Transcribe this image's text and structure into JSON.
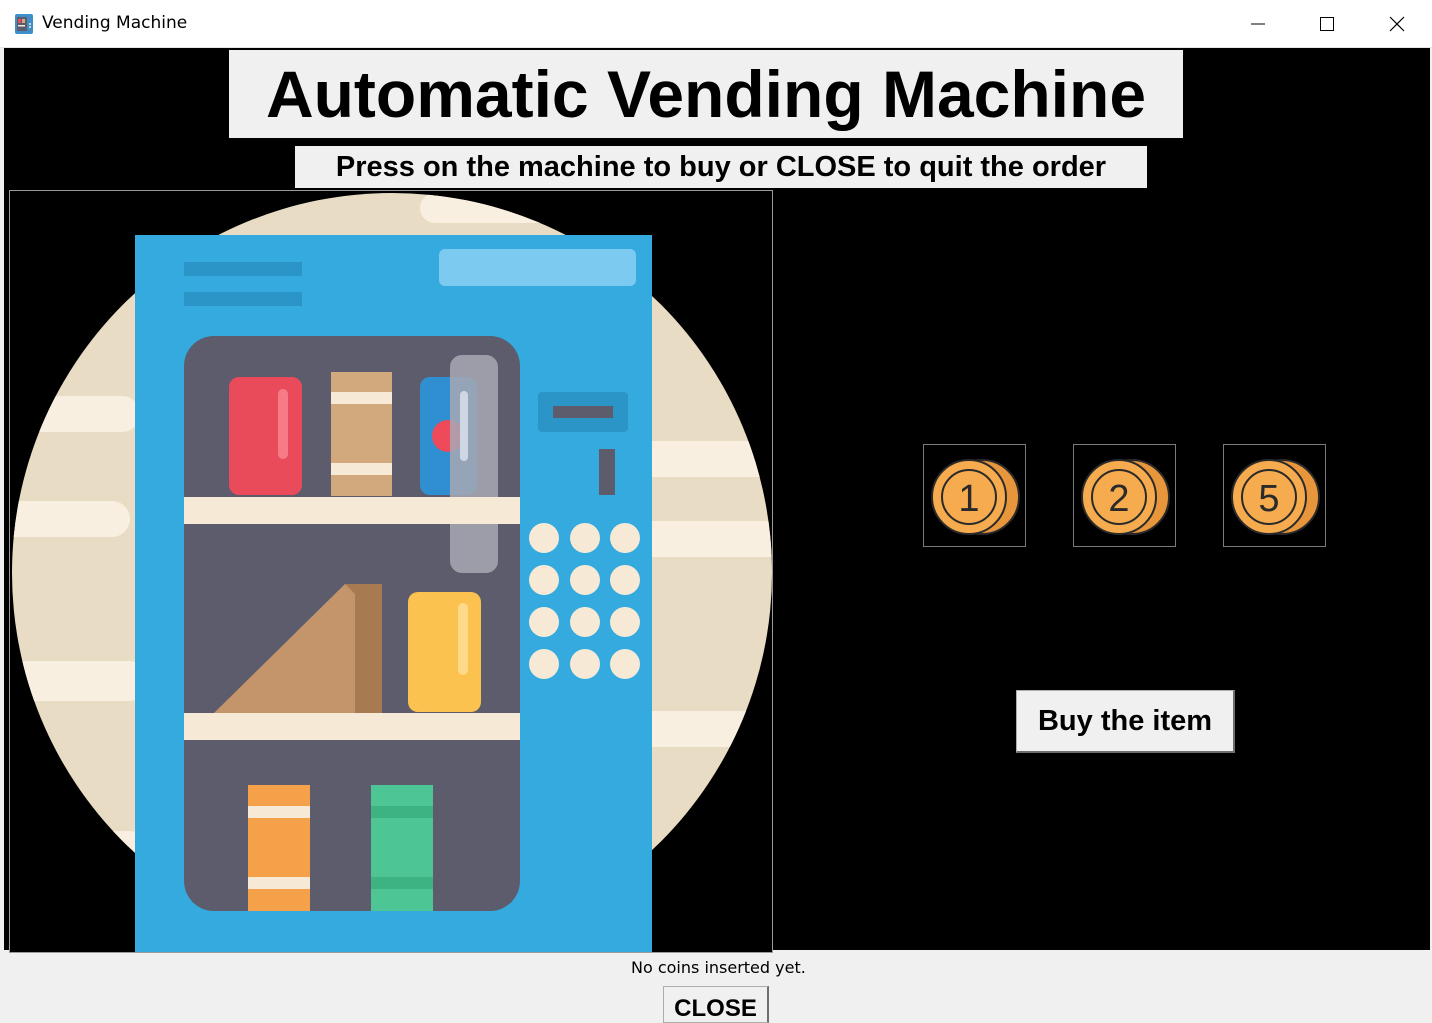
{
  "window": {
    "title": "Vending Machine",
    "icon": "vending-machine-app-icon",
    "controls": [
      "minimize-icon",
      "maximize-icon",
      "close-icon"
    ]
  },
  "header": {
    "title": "Automatic Vending Machine",
    "subtitle": "Press on the machine to buy or CLOSE to quit the order"
  },
  "machine": {
    "image": "vending-machine-illustration",
    "colors": {
      "body": "#35aadf",
      "inner": "#5c5c6d",
      "backdrop": "#e9dcc5"
    }
  },
  "coins": [
    {
      "label": "1",
      "name": "coin-1-button"
    },
    {
      "label": "2",
      "name": "coin-2-button"
    },
    {
      "label": "5",
      "name": "coin-5-button"
    }
  ],
  "buy_button": {
    "label": "Buy the item"
  },
  "status": {
    "text": "No coins inserted yet."
  },
  "close_button": {
    "label": "CLOSE"
  },
  "colors": {
    "canvas_bg": "#000000",
    "panel_bg": "#f0f0f0",
    "coin": "#f6ab4e"
  }
}
